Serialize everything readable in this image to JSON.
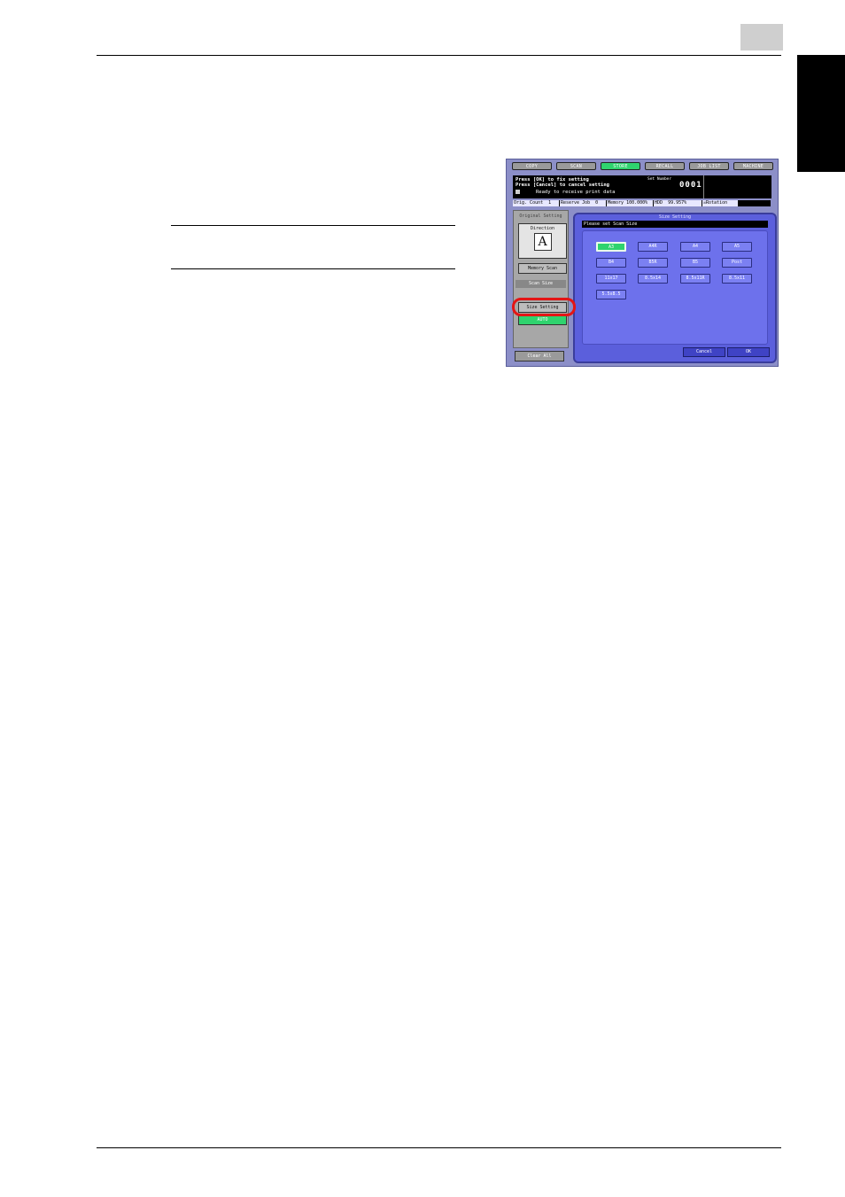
{
  "page": {
    "header_rule_color": "#000000",
    "chapter_box_color": "#cfcfcf",
    "side_tab_color": "#000000"
  },
  "screen": {
    "tabs": [
      {
        "label": "COPY",
        "active": false
      },
      {
        "label": "SCAN",
        "active": false
      },
      {
        "label": "STORE",
        "active": true
      },
      {
        "label": "RECALL",
        "active": false
      },
      {
        "label": "JOB LIST",
        "active": false
      },
      {
        "label": "MACHINE",
        "active": false
      }
    ],
    "message_line1": "Press [OK] to fix setting",
    "message_line2": "Press [Cancel] to cancel setting",
    "ready_text": "Ready to receive print data",
    "set_number_label": "Set Number",
    "set_number_value": "0001",
    "status": {
      "orig_count_label": "Orig. Count",
      "orig_count_value": "1",
      "reserve_job_label": "Reserve Job",
      "reserve_job_value": "0",
      "memory_label": "Memory",
      "memory_value": "100.000%",
      "hdd_label": "HDD",
      "hdd_value": "99.957%",
      "rotation_label": "Rotation"
    },
    "left_panel": {
      "original_setting": "Original Setting",
      "direction_label": "Direction",
      "direction_glyph": "A",
      "memory_scan": "Memory Scan",
      "scan_size": "Scan Size",
      "size_setting": "Size Setting",
      "auto": "AUTO",
      "clear_all": "Clear All"
    },
    "dialog": {
      "title": "Size Setting",
      "prompt": "Please set Scan Size",
      "sizes": [
        "A3",
        "A4R",
        "A4",
        "A5",
        "B4",
        "B5R",
        "B5",
        "Post",
        "11x17",
        "8.5x14",
        "8.5x11R",
        "8.5x11",
        "5.5x8.5"
      ],
      "selected": "A3",
      "cancel": "Cancel",
      "ok": "OK"
    },
    "highlight_color": "#e41515"
  }
}
